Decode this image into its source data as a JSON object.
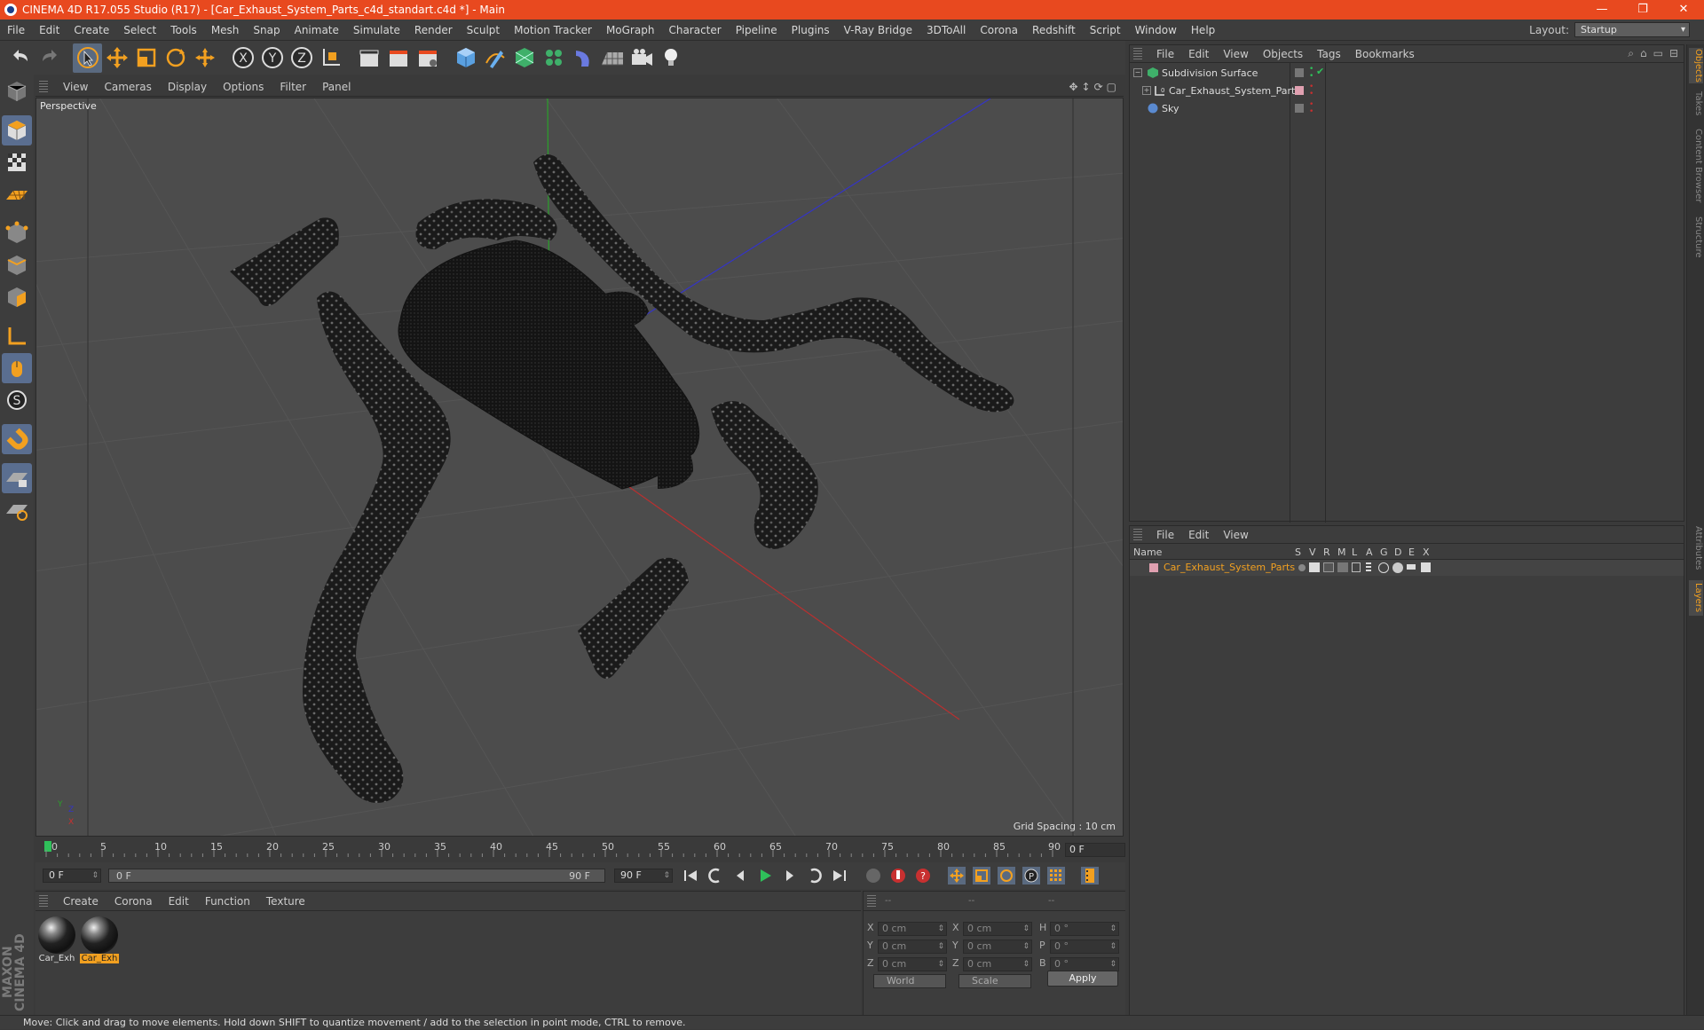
{
  "window": {
    "title": "CINEMA 4D R17.055 Studio (R17) - [Car_Exhaust_System_Parts_c4d_standart.c4d *] - Main",
    "minimize": "—",
    "restore": "❐",
    "close": "✕"
  },
  "menu": [
    "File",
    "Edit",
    "Create",
    "Select",
    "Tools",
    "Mesh",
    "Snap",
    "Animate",
    "Simulate",
    "Render",
    "Sculpt",
    "Motion Tracker",
    "MoGraph",
    "Character",
    "Pipeline",
    "Plugins",
    "V-Ray Bridge",
    "3DToAll",
    "Corona",
    "Redshift",
    "Script",
    "Window",
    "Help"
  ],
  "layout": {
    "label": "Layout:",
    "value": "Startup"
  },
  "viewport": {
    "menu": [
      "View",
      "Cameras",
      "Display",
      "Options",
      "Filter",
      "Panel"
    ],
    "label": "Perspective",
    "grid_spacing": "Grid Spacing : 10 cm",
    "axis_x": "X",
    "axis_y": "Y",
    "axis_z": "Z"
  },
  "timeline": {
    "ticks": [
      "0",
      "5",
      "10",
      "15",
      "20",
      "25",
      "30",
      "35",
      "40",
      "45",
      "50",
      "55",
      "60",
      "65",
      "70",
      "75",
      "80",
      "85",
      "90"
    ],
    "current_frame": "0 F",
    "start_field": "0 F",
    "slider_start": "0 F",
    "slider_end": "90 F",
    "end_field": "90 F"
  },
  "materials": {
    "menu": [
      "Create",
      "Corona",
      "Edit",
      "Function",
      "Texture"
    ],
    "items": [
      {
        "label": "Car_Exh",
        "selected": false
      },
      {
        "label": "Car_Exh",
        "selected": true
      }
    ]
  },
  "coordinates": {
    "header": [
      "--",
      "--",
      "--"
    ],
    "rows": [
      {
        "a": "X",
        "v1": "0 cm",
        "b": "X",
        "v2": "0 cm",
        "c": "H",
        "v3": "0 °"
      },
      {
        "a": "Y",
        "v1": "0 cm",
        "b": "Y",
        "v2": "0 cm",
        "c": "P",
        "v3": "0 °"
      },
      {
        "a": "Z",
        "v1": "0 cm",
        "b": "Z",
        "v2": "0 cm",
        "c": "B",
        "v3": "0 °"
      }
    ],
    "world": "World",
    "scale": "Scale",
    "apply": "Apply"
  },
  "brand": "MAXON CINEMA 4D",
  "status": "Move: Click and drag to move elements. Hold down SHIFT to quantize movement / add to the selection in point mode, CTRL to remove.",
  "objects": {
    "menu": [
      "File",
      "Edit",
      "View",
      "Objects",
      "Tags",
      "Bookmarks"
    ],
    "items": [
      {
        "name": "Subdivision Surface",
        "icon": "subdivision-icon"
      },
      {
        "name": "Car_Exhaust_System_Parts",
        "icon": "null-icon"
      },
      {
        "name": "Sky",
        "icon": "sky-icon"
      }
    ]
  },
  "layers": {
    "menu": [
      "File",
      "Edit",
      "View"
    ],
    "columns": [
      "Name",
      "S",
      "V",
      "R",
      "M",
      "L",
      "A",
      "G",
      "D",
      "E",
      "X"
    ],
    "row": "Car_Exhaust_System_Parts"
  },
  "side_tabs": [
    "Objects",
    "Takes",
    "Content Browser",
    "Structure"
  ],
  "side_tabs2": [
    "Attributes",
    "Layers"
  ],
  "colors": {
    "title_bar": "#e8491f",
    "accent": "#f2a020",
    "active_tool": "#5a6a80"
  }
}
